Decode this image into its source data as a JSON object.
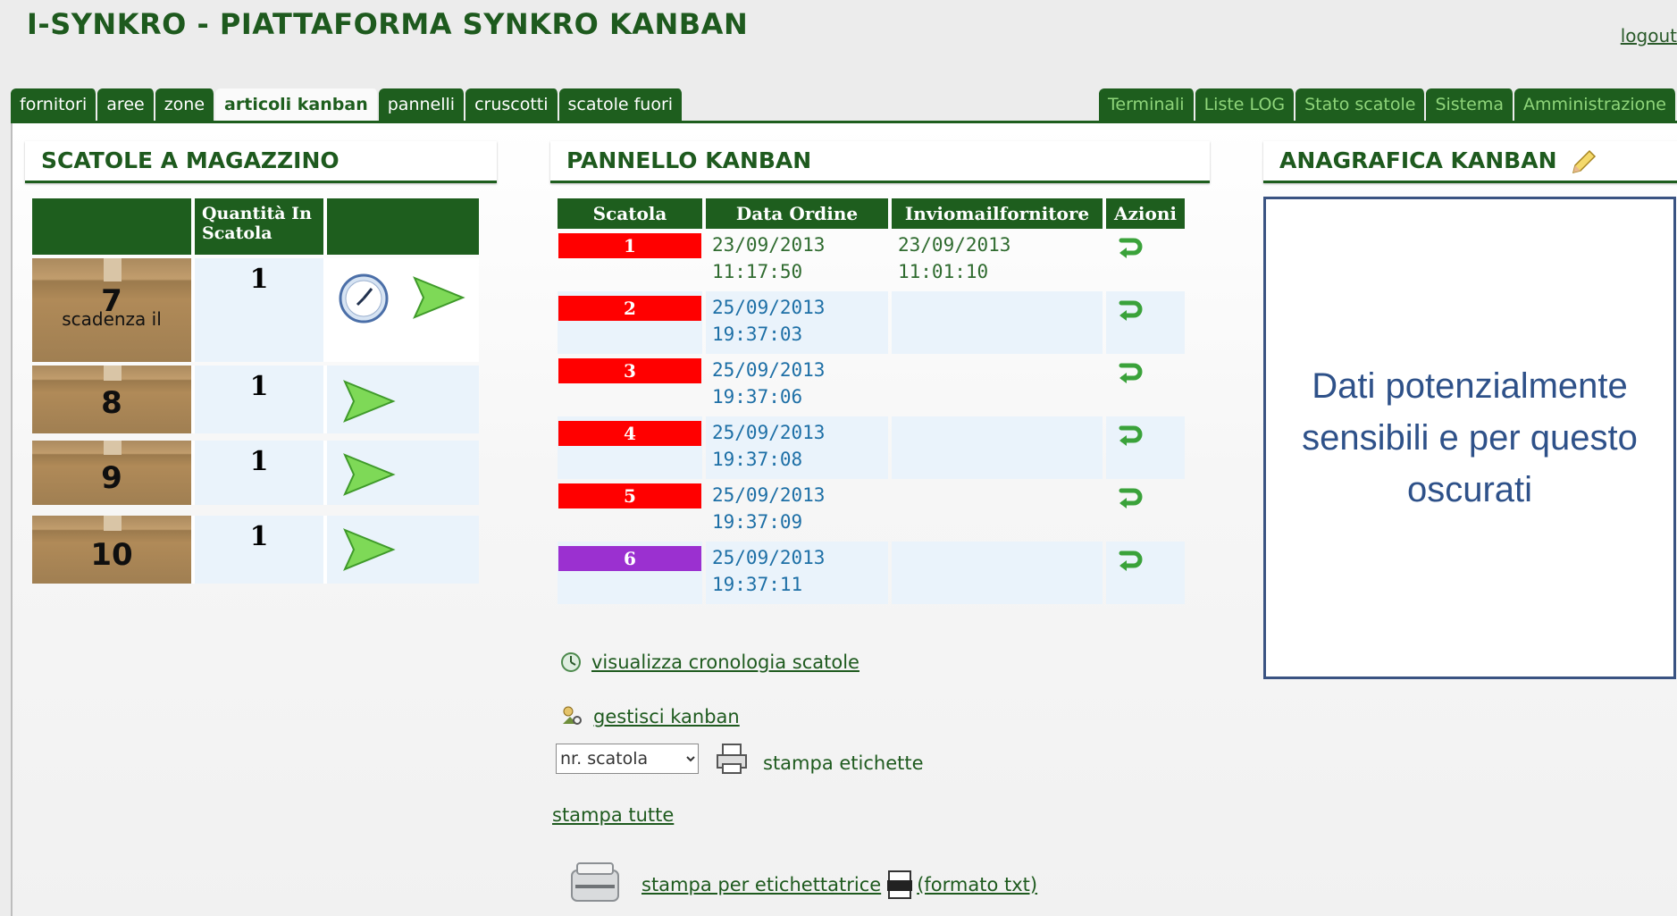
{
  "app": {
    "title": "I-SYNKRO - PIATTAFORMA SYNKRO KANBAN",
    "logout": "logout"
  },
  "tabs_left": [
    {
      "label": "fornitori",
      "active": false
    },
    {
      "label": "aree",
      "active": false
    },
    {
      "label": "zone",
      "active": false
    },
    {
      "label": "articoli kanban",
      "active": true
    },
    {
      "label": "pannelli",
      "active": false
    },
    {
      "label": "cruscotti",
      "active": false
    },
    {
      "label": "scatole fuori",
      "active": false
    }
  ],
  "tabs_right": [
    {
      "label": "Terminali"
    },
    {
      "label": "Liste LOG"
    },
    {
      "label": "Stato scatole"
    },
    {
      "label": "Sistema"
    },
    {
      "label": "Amministrazione"
    }
  ],
  "magazzino": {
    "title": "SCATOLE A MAGAZZINO",
    "headers": [
      "",
      "Quantità In Scatola",
      ""
    ],
    "rows": [
      {
        "box": "7",
        "note": "scadenza il",
        "qty": "1",
        "has_clock": true
      },
      {
        "box": "8",
        "note": "",
        "qty": "1",
        "has_clock": false
      },
      {
        "box": "9",
        "note": "",
        "qty": "1",
        "has_clock": false
      },
      {
        "box": "10",
        "note": "",
        "qty": "1",
        "has_clock": false
      }
    ]
  },
  "pannello": {
    "title": "PANNELLO KANBAN",
    "headers": [
      "Scatola",
      "Data Ordine",
      "Inviomailfornitore",
      "Azioni"
    ],
    "rows": [
      {
        "scatola": "1",
        "color": "#ff0000",
        "data_date": "23/09/2013",
        "data_time": "11:17:50",
        "mail_date": "23/09/2013",
        "mail_time": "11:01:10",
        "sent": true
      },
      {
        "scatola": "2",
        "color": "#ff0000",
        "data_date": "25/09/2013",
        "data_time": "19:37:03",
        "mail_date": "",
        "mail_time": "",
        "sent": false
      },
      {
        "scatola": "3",
        "color": "#ff0000",
        "data_date": "25/09/2013",
        "data_time": "19:37:06",
        "mail_date": "",
        "mail_time": "",
        "sent": false
      },
      {
        "scatola": "4",
        "color": "#ff0000",
        "data_date": "25/09/2013",
        "data_time": "19:37:08",
        "mail_date": "",
        "mail_time": "",
        "sent": false
      },
      {
        "scatola": "5",
        "color": "#ff0000",
        "data_date": "25/09/2013",
        "data_time": "19:37:09",
        "mail_date": "",
        "mail_time": "",
        "sent": false
      },
      {
        "scatola": "6",
        "color": "#9b30d0",
        "data_date": "25/09/2013",
        "data_time": "19:37:11",
        "mail_date": "",
        "mail_time": "",
        "sent": false
      }
    ],
    "links": {
      "cronologia": "visualizza cronologia scatole",
      "gestisci": "gestisci kanban",
      "select_value": "nr. scatola",
      "stampa_etichette": "stampa etichette",
      "stampa_tutte": "stampa tutte",
      "stampa_etichettatrice": "stampa per etichettatrice",
      "formato_txt": "(formato txt)"
    }
  },
  "anagrafica": {
    "title": "ANAGRAFICA KANBAN",
    "overlay_text": "Dati potenzialmente sensibili e per questo oscurati"
  },
  "colors": {
    "brand_green": "#1e5e1e",
    "row_alt": "#eaf3fb"
  }
}
